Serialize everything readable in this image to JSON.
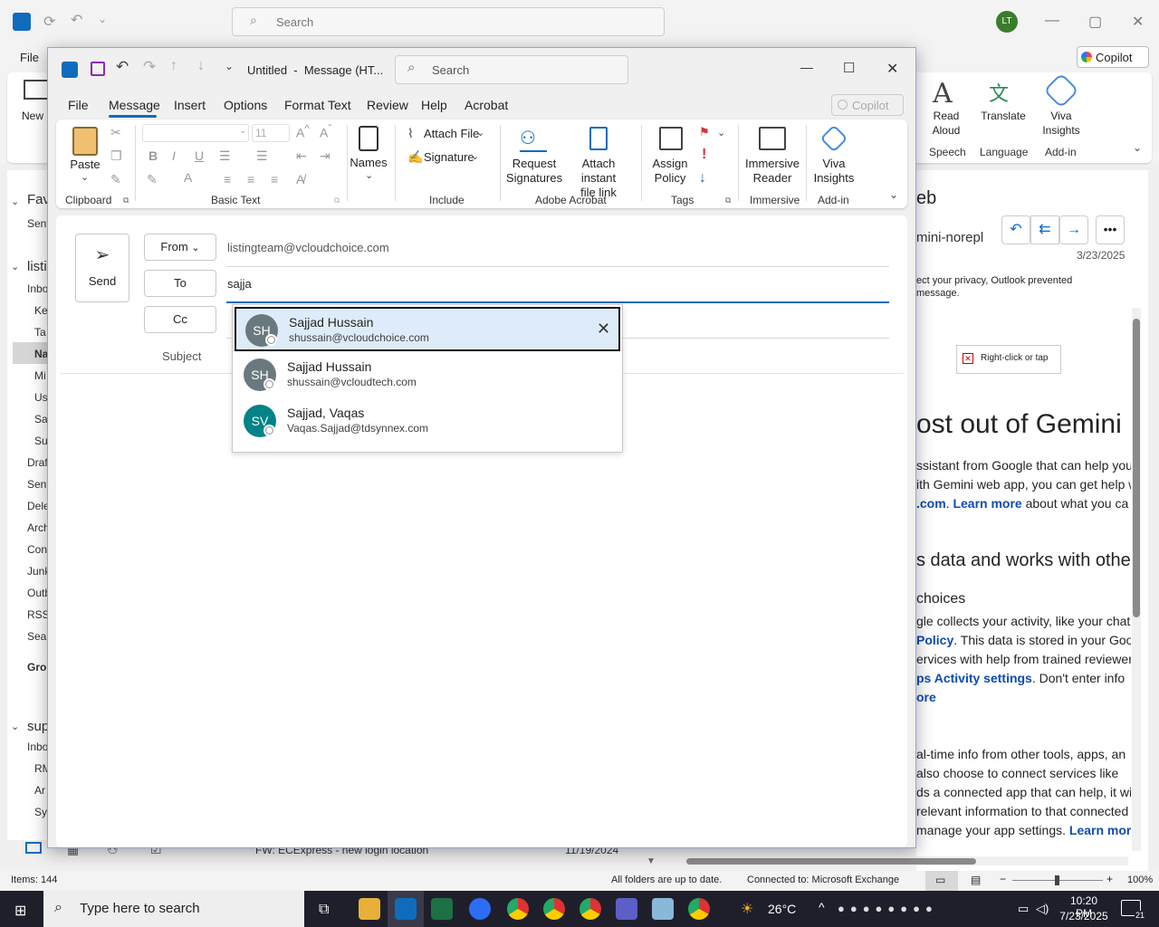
{
  "background": {
    "search_placeholder": "Search",
    "avatar_initials": "LT",
    "file_menu": "File",
    "copilot_label": "Copilot",
    "ribbon": {
      "new_email": "New Email",
      "read_aloud": "Read Aloud",
      "translate": "Translate",
      "viva_insights": "Viva Insights",
      "groups": [
        "Speech",
        "Language",
        "Add-in"
      ]
    },
    "nav_items": [
      "Fav",
      "Sent",
      "listi",
      "Inbo",
      "Ke",
      "Ta",
      "Na",
      "Mi",
      "Us",
      "Sa",
      "Su",
      "Draf",
      "Sent",
      "Dele",
      "Arch",
      "Con",
      "Junk",
      "Outb",
      "RSS",
      "Sear",
      "Grou",
      "sup",
      "Inbo",
      "RM",
      "Ar",
      "Sy"
    ],
    "message_list_bottom": {
      "subject": "FW: ECExpress - new login location",
      "date": "11/19/2024"
    },
    "reading_pane": {
      "title_fragment": "eb",
      "sender_fragment": "mini-norepl",
      "date": "3/23/2025",
      "privacy_note_line1": "ect your privacy, Outlook prevented",
      "privacy_note_line2": "message.",
      "image_placeholder": "Right-click or tap",
      "heading1": "ost out of Gemini",
      "p1_line1": "ssistant from Google that can help you",
      "p1_line2": "ith Gemini web app, you can get help wr",
      "p1_link1": ".com",
      "p1_link2": "Learn more",
      "p1_line3_rest": "about what you ca",
      "heading2": "s data and works with othe",
      "heading3": "choices",
      "p2_line1": "gle collects your activity, like your chat",
      "p2_link1": "Policy",
      "p2_line2_rest": ". This data is stored in your Goo",
      "p2_line3": "ervices with help from trained reviewer",
      "p2_link2": "ps Activity settings",
      "p2_line4_rest": ". Don't enter info",
      "p2_link3": "ore",
      "p3_line1": "al-time info from other tools, apps, an",
      "p3_line2": "also choose to connect services like",
      "p3_line3": "ds a connected app that can help, it wil",
      "p3_line4": "relevant information to that connected",
      "p3_line5": "manage your app settings.",
      "p3_link": "Learn more"
    },
    "status": {
      "items": "Items: 144",
      "sync": "All folders are up to date.",
      "connection": "Connected to: Microsoft Exchange",
      "zoom": "100%"
    }
  },
  "taskbar": {
    "search_placeholder": "Type here to search",
    "weather": "26°C",
    "time": "10:20 PM",
    "date": "7/23/2025",
    "notifications": "21"
  },
  "compose": {
    "title": "Untitled  -  Message (HT...",
    "search_placeholder": "Search",
    "tabs": [
      "File",
      "Message",
      "Insert",
      "Options",
      "Format Text",
      "Review",
      "Help",
      "Acrobat"
    ],
    "copilot_label": "Copilot",
    "ribbon": {
      "paste": "Paste",
      "font_size": "11",
      "names": "Names",
      "attach_file": "Attach File",
      "signature": "Signature",
      "request_signatures": "Request Signatures",
      "attach_instant_link_1": "Attach instant",
      "attach_instant_link_2": "file link",
      "assign_policy_1": "Assign",
      "assign_policy_2": "Policy",
      "immersive_reader_1": "Immersive",
      "immersive_reader_2": "Reader",
      "viva_insights_1": "Viva",
      "viva_insights_2": "Insights",
      "groups": {
        "clipboard": "Clipboard",
        "basic_text": "Basic Text",
        "include": "Include",
        "adobe_acrobat": "Adobe Acrobat",
        "tags": "Tags",
        "immersive": "Immersive",
        "add_in": "Add-in"
      }
    },
    "send_label": "Send",
    "from_label": "From",
    "from_value": "listingteam@vcloudchoice.com",
    "to_label": "To",
    "to_value": "sajja",
    "cc_label": "Cc",
    "subject_label": "Subject",
    "suggestions": [
      {
        "initials": "SH",
        "name": "Sajjad Hussain",
        "email": "shussain@vcloudchoice.com",
        "color": "#69797e"
      },
      {
        "initials": "SH",
        "name": "Sajjad Hussain",
        "email": "shussain@vcloudtech.com",
        "color": "#69797e"
      },
      {
        "initials": "SV",
        "name": "Sajjad, Vaqas",
        "email": "Vaqas.Sajjad@tdsynnex.com",
        "color": "#038387"
      }
    ]
  }
}
